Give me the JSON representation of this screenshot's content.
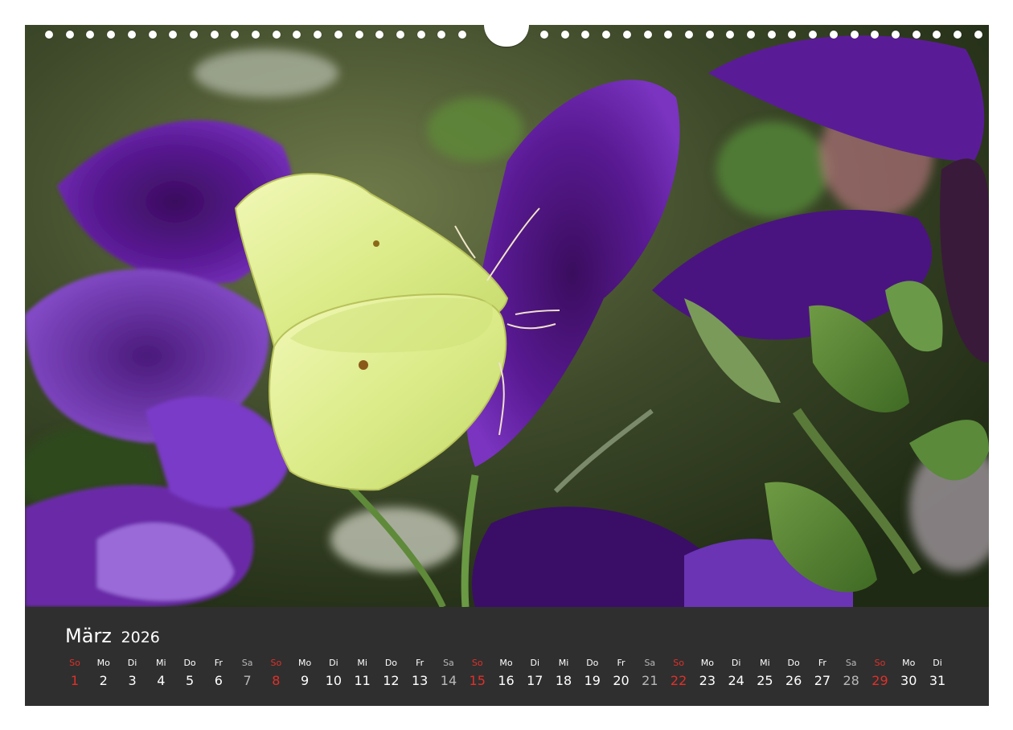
{
  "calendar": {
    "month": "März",
    "year": "2026",
    "days": [
      {
        "dow": "So",
        "num": "1",
        "type": "sunday"
      },
      {
        "dow": "Mo",
        "num": "2",
        "type": "weekday"
      },
      {
        "dow": "Di",
        "num": "3",
        "type": "weekday"
      },
      {
        "dow": "Mi",
        "num": "4",
        "type": "weekday"
      },
      {
        "dow": "Do",
        "num": "5",
        "type": "weekday"
      },
      {
        "dow": "Fr",
        "num": "6",
        "type": "weekday"
      },
      {
        "dow": "Sa",
        "num": "7",
        "type": "saturday"
      },
      {
        "dow": "So",
        "num": "8",
        "type": "sunday"
      },
      {
        "dow": "Mo",
        "num": "9",
        "type": "weekday"
      },
      {
        "dow": "Di",
        "num": "10",
        "type": "weekday"
      },
      {
        "dow": "Mi",
        "num": "11",
        "type": "weekday"
      },
      {
        "dow": "Do",
        "num": "12",
        "type": "weekday"
      },
      {
        "dow": "Fr",
        "num": "13",
        "type": "weekday"
      },
      {
        "dow": "Sa",
        "num": "14",
        "type": "saturday"
      },
      {
        "dow": "So",
        "num": "15",
        "type": "sunday"
      },
      {
        "dow": "Mo",
        "num": "16",
        "type": "weekday"
      },
      {
        "dow": "Di",
        "num": "17",
        "type": "weekday"
      },
      {
        "dow": "Mi",
        "num": "18",
        "type": "weekday"
      },
      {
        "dow": "Do",
        "num": "19",
        "type": "weekday"
      },
      {
        "dow": "Fr",
        "num": "20",
        "type": "weekday"
      },
      {
        "dow": "Sa",
        "num": "21",
        "type": "saturday"
      },
      {
        "dow": "So",
        "num": "22",
        "type": "sunday"
      },
      {
        "dow": "Mo",
        "num": "23",
        "type": "weekday"
      },
      {
        "dow": "Di",
        "num": "24",
        "type": "weekday"
      },
      {
        "dow": "Mi",
        "num": "25",
        "type": "weekday"
      },
      {
        "dow": "Do",
        "num": "26",
        "type": "weekday"
      },
      {
        "dow": "Fr",
        "num": "27",
        "type": "weekday"
      },
      {
        "dow": "Sa",
        "num": "28",
        "type": "saturday"
      },
      {
        "dow": "So",
        "num": "29",
        "type": "sunday"
      },
      {
        "dow": "Mo",
        "num": "30",
        "type": "weekday"
      },
      {
        "dow": "Di",
        "num": "31",
        "type": "weekday"
      }
    ]
  },
  "colors": {
    "strip_background": "#2f2f2f",
    "sunday": "#e0302a",
    "saturday": "#b8b8b8",
    "weekday": "#ffffff"
  },
  "photo": {
    "subject": "brimstone-butterfly-on-purple-petunias"
  }
}
